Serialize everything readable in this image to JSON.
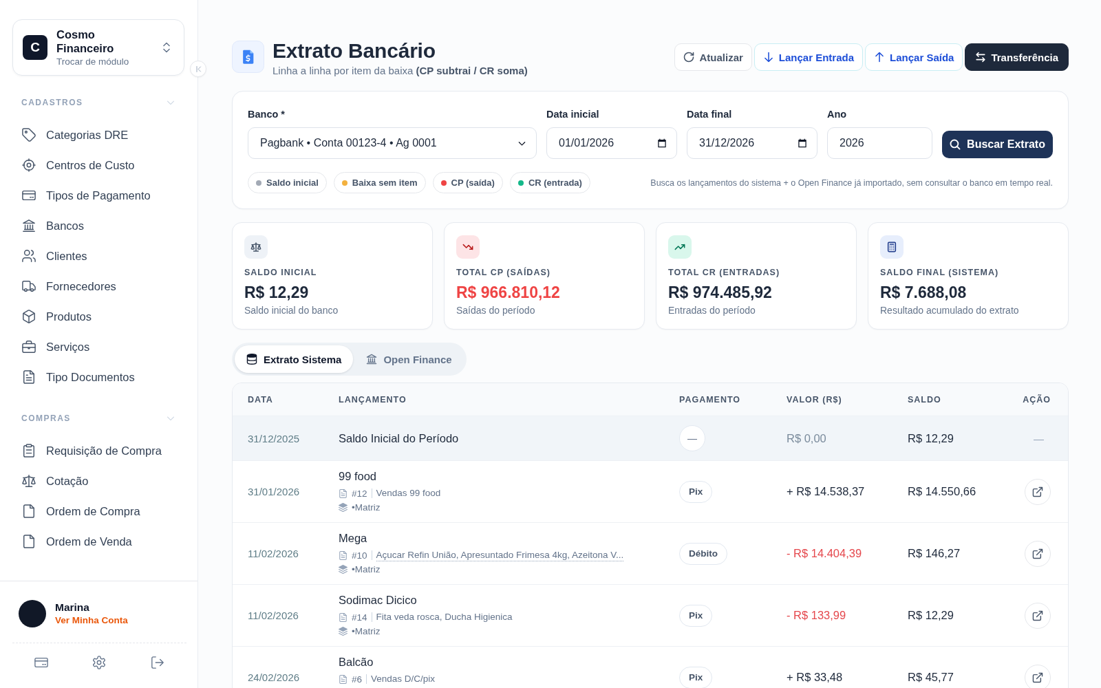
{
  "sidebar": {
    "module": {
      "logo": "C",
      "title": "Cosmo Financeiro",
      "subtitle": "Trocar de módulo"
    },
    "sections": [
      {
        "title": "CADASTROS",
        "expanded": true,
        "items": [
          "Categorias DRE",
          "Centros de Custo",
          "Tipos de Pagamento",
          "Bancos",
          "Clientes",
          "Fornecedores",
          "Produtos",
          "Serviços",
          "Tipo Documentos"
        ]
      },
      {
        "title": "COMPRAS",
        "expanded": true,
        "items": [
          "Requisição de Compra",
          "Cotação",
          "Ordem de Compra",
          "Ordem de Venda"
        ]
      }
    ],
    "user": {
      "name": "Marina",
      "link": "Ver Minha Conta"
    }
  },
  "header": {
    "title": "Extrato Bancário",
    "subtitle": "Linha a linha por item da baixa **(CP subtrai / CR soma)**"
  },
  "actions": [
    {
      "label": "Atualizar",
      "kind": "refresh"
    },
    {
      "label": "Lançar Entrada",
      "kind": "inflow"
    },
    {
      "label": "Lançar Saída",
      "kind": "outflow"
    },
    {
      "label": "Transferência",
      "kind": "transfer"
    }
  ],
  "filters": {
    "fields": [
      {
        "label": "Banco *",
        "kind": "select",
        "value": "Pagbank • Conta 00123-4 • Ag 0001"
      },
      {
        "label": "Data inicial",
        "kind": "date",
        "value": "01/01/2026"
      },
      {
        "label": "Data final",
        "kind": "date",
        "value": "31/12/2026"
      },
      {
        "label": "Ano",
        "kind": "text",
        "value": "2026"
      }
    ],
    "button": "Buscar Extrato",
    "legend": [
      {
        "label": "Saldo inicial",
        "color": "#a3aab5"
      },
      {
        "label": "Baixa sem item",
        "color": "#f3b13f"
      },
      {
        "label": "CP (saída)",
        "color": "#ef4444"
      },
      {
        "label": "CR (entrada)",
        "color": "#14b88a"
      }
    ],
    "note": "Busca os lançamentos do sistema + o Open Finance já importado, sem consultar o banco em tempo real."
  },
  "summary_cards": [
    {
      "kind": "initial",
      "label": "SALDO INICIAL",
      "value": "R$ 12,29",
      "caption": "Saldo inicial do banco"
    },
    {
      "kind": "outflow",
      "label": "TOTAL CP (SAÍDAS)",
      "value": "R$ 966.810,12",
      "caption": "Saídas do período"
    },
    {
      "kind": "inflow",
      "label": "TOTAL CR (ENTRADAS)",
      "value": "R$ 974.485,92",
      "caption": "Entradas do período"
    },
    {
      "kind": "final",
      "label": "SALDO FINAL (SISTEMA)",
      "value": "R$ 7.688,08",
      "caption": "Resultado acumulado do extrato"
    }
  ],
  "tabs": [
    {
      "label": "Extrato Sistema",
      "selected": true
    },
    {
      "label": "Open Finance",
      "selected": false
    }
  ],
  "table": {
    "columns": [
      "DATA",
      "LANÇAMENTO",
      "PAGAMENTO",
      "VALOR (R$)",
      "SALDO",
      "AÇÃO"
    ],
    "rows": [
      {
        "kind": "opening",
        "date": "31/12/2025",
        "title": "Saldo Inicial do Período",
        "payment": "—",
        "amount": "R$ 0,00",
        "balance": "R$ 12,29",
        "action": "—"
      },
      {
        "kind": "inflow",
        "date": "31/01/2026",
        "title": "99 food",
        "doc": "#12",
        "description": "Vendas 99 food",
        "truncated": false,
        "branch": "•Matriz",
        "payment": "Pix",
        "amount": "+ R$ 14.538,37",
        "balance": "R$ 14.550,66"
      },
      {
        "kind": "outflow",
        "date": "11/02/2026",
        "title": "Mega",
        "doc": "#10",
        "description": "Açucar Refin União, Apresuntado Frimesa 4kg, Azeitona V...",
        "truncated": true,
        "branch": "•Matriz",
        "payment": "Débito",
        "amount": "- R$ 14.404,39",
        "balance": "R$ 146,27"
      },
      {
        "kind": "outflow",
        "date": "11/02/2026",
        "title": "Sodimac Dicico",
        "doc": "#14",
        "description": "Fita veda rosca, Ducha Higienica",
        "truncated": false,
        "branch": "•Matriz",
        "payment": "Pix",
        "amount": "- R$ 133,99",
        "balance": "R$ 12,29"
      },
      {
        "kind": "inflow",
        "date": "24/02/2026",
        "title": "Balcão",
        "doc": "#6",
        "description": "Vendas D/C/pix",
        "truncated": false,
        "payment": "Pix",
        "amount": "+ R$ 33,48",
        "balance": "R$ 45,77"
      }
    ]
  }
}
